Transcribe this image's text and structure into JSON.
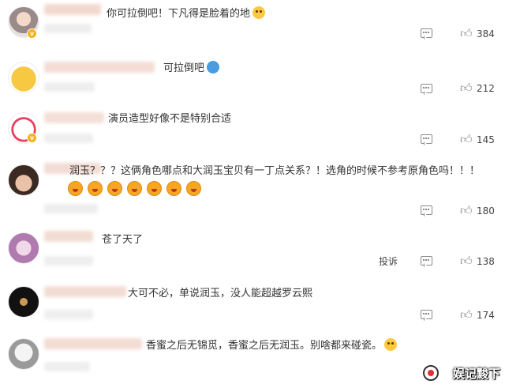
{
  "comments": [
    {
      "text": "你可拉倒吧！下凡得是脸着的地",
      "likes": "384"
    },
    {
      "text": "可拉倒吧",
      "likes": "212"
    },
    {
      "text": "演员造型好像不是特别合适",
      "likes": "145"
    },
    {
      "text": "润玉？？？这俩角色哪点和大润玉宝贝有一丁点关系？！选角的时候不参考原角色吗！！！",
      "likes": "180"
    },
    {
      "text": "苍了天了",
      "likes": "138",
      "report": "投诉"
    },
    {
      "text": "大可不必，单说润玉，没人能超越罗云熙",
      "likes": "174"
    },
    {
      "text": "香蜜之后无锦觅，香蜜之后无润玉。别啥都来碰瓷。",
      "likes": ""
    }
  ],
  "icons": {
    "comment": "comment-bubble-icon",
    "like": "thumbs-up-icon",
    "emoji": "emoji-icon"
  },
  "watermark": "娱记黢下"
}
